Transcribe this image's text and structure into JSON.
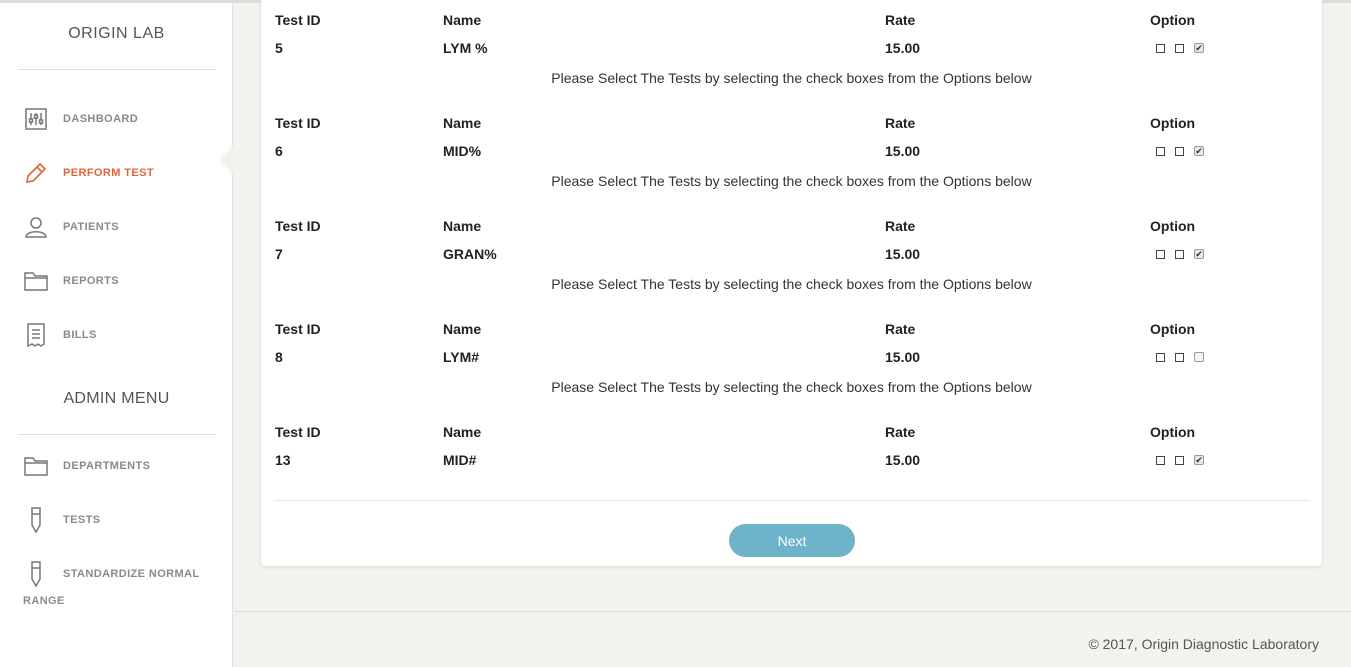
{
  "sidebar": {
    "brand": "ORIGIN LAB",
    "items": [
      {
        "label": "DASHBOARD",
        "icon": "sliders-icon"
      },
      {
        "label": "PERFORM TEST",
        "icon": "pencil-icon",
        "active": true
      },
      {
        "label": "PATIENTS",
        "icon": "user-icon"
      },
      {
        "label": "REPORTS",
        "icon": "folder-icon"
      },
      {
        "label": "BILLS",
        "icon": "receipt-icon"
      }
    ],
    "admin_title": "ADMIN MENU",
    "admin_items": [
      {
        "label": "DEPARTMENTS",
        "icon": "folder-icon"
      },
      {
        "label": "TESTS",
        "icon": "test-tube-icon"
      },
      {
        "label": "STANDARDIZE NORMAL",
        "icon": "test-tube-icon"
      }
    ],
    "admin_item_wrap": "RANGE",
    "accent_color": "#e0643a"
  },
  "table": {
    "headers": {
      "id": "Test ID",
      "name": "Name",
      "rate": "Rate",
      "option": "Option"
    },
    "note": "Please Select The Tests by selecting the check boxes from the Options below",
    "rows": [
      {
        "id": "5",
        "name": "LYM %",
        "rate": "15.00",
        "checked": true
      },
      {
        "id": "6",
        "name": "MID%",
        "rate": "15.00",
        "checked": true
      },
      {
        "id": "7",
        "name": "GRAN%",
        "rate": "15.00",
        "checked": true
      },
      {
        "id": "8",
        "name": "LYM#",
        "rate": "15.00",
        "checked": false
      },
      {
        "id": "13",
        "name": "MID#",
        "rate": "15.00",
        "checked": true
      }
    ]
  },
  "actions": {
    "next_label": "Next",
    "next_color": "#6db3c9"
  },
  "footer": {
    "text": "© 2017, Origin Diagnostic Laboratory"
  }
}
